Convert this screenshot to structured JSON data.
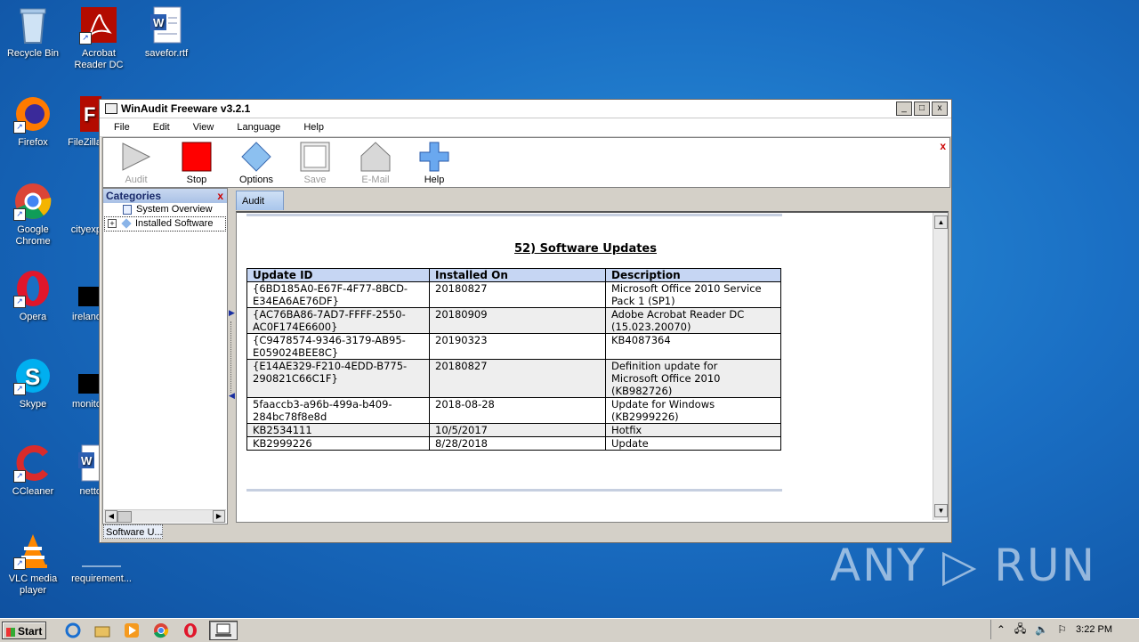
{
  "desktop": {
    "icons": [
      {
        "label": "Recycle Bin",
        "icon": "recycle-bin-icon"
      },
      {
        "label": "Acrobat Reader DC",
        "icon": "acrobat-icon"
      },
      {
        "label": "savefor.rtf",
        "icon": "word-doc-icon"
      },
      {
        "label": "Firefox",
        "icon": "firefox-icon"
      },
      {
        "label": "FileZilla",
        "icon": "filezilla-icon"
      },
      {
        "label": "Google Chrome",
        "icon": "chrome-icon"
      },
      {
        "label": "cityexp",
        "icon": "file-icon"
      },
      {
        "label": "Opera",
        "icon": "opera-icon"
      },
      {
        "label": "ireland",
        "icon": "file-icon"
      },
      {
        "label": "Skype",
        "icon": "skype-icon"
      },
      {
        "label": "monito",
        "icon": "file-icon"
      },
      {
        "label": "CCleaner",
        "icon": "ccleaner-icon"
      },
      {
        "label": "netto",
        "icon": "word-doc-icon"
      },
      {
        "label": "VLC media player",
        "icon": "vlc-icon"
      },
      {
        "label": "requirement...",
        "icon": "file-icon"
      }
    ],
    "watermark": "ANY ▷ RUN"
  },
  "window": {
    "title": "WinAudit Freeware v3.2.1",
    "controls": {
      "minimize": "_",
      "maximize": "□",
      "close": "x"
    },
    "menu": [
      "File",
      "Edit",
      "View",
      "Language",
      "Help"
    ],
    "toolbar": [
      {
        "label": "Audit",
        "enabled": false
      },
      {
        "label": "Stop",
        "enabled": true
      },
      {
        "label": "Options",
        "enabled": true
      },
      {
        "label": "Save",
        "enabled": false
      },
      {
        "label": "E-Mail",
        "enabled": false
      },
      {
        "label": "Help",
        "enabled": true
      }
    ],
    "toolbar_close": "x",
    "categories": {
      "header": "Categories",
      "close": "x",
      "items": [
        "System Overview",
        "Installed Software"
      ]
    },
    "tab": "Audit",
    "section_title": "52) Software Updates",
    "table": {
      "headers": [
        "Update ID",
        "Installed On",
        "Description"
      ],
      "rows": [
        [
          "{6BD185A0-E67F-4F77-8BCD-\nE34EA6AE76DF}",
          "20180827",
          "Microsoft Office 2010 Service\nPack 1 (SP1)"
        ],
        [
          "{AC76BA86-7AD7-FFFF-2550-\nAC0F174E6600}",
          "20180909",
          "Adobe Acrobat Reader DC\n(15.023.20070)"
        ],
        [
          "{C9478574-9346-3179-AB95-\nE059024BEE8C}",
          "20190323",
          "KB4087364"
        ],
        [
          "{E14AE329-F210-4EDD-B775-\n290821C66C1F}",
          "20180827",
          "Definition update for\nMicrosoft Office 2010\n(KB982726)"
        ],
        [
          "5faaccb3-a96b-499a-b409-\n284bc78f8e8d",
          "2018-08-28",
          "Update for Windows\n(KB2999226)"
        ],
        [
          "KB2534111",
          "10/5/2017",
          "Hotfix"
        ],
        [
          "KB2999226",
          "8/28/2018",
          "Update"
        ]
      ]
    },
    "status": "Software U..."
  },
  "taskbar": {
    "start": "Start",
    "clock": "3:22 PM"
  }
}
